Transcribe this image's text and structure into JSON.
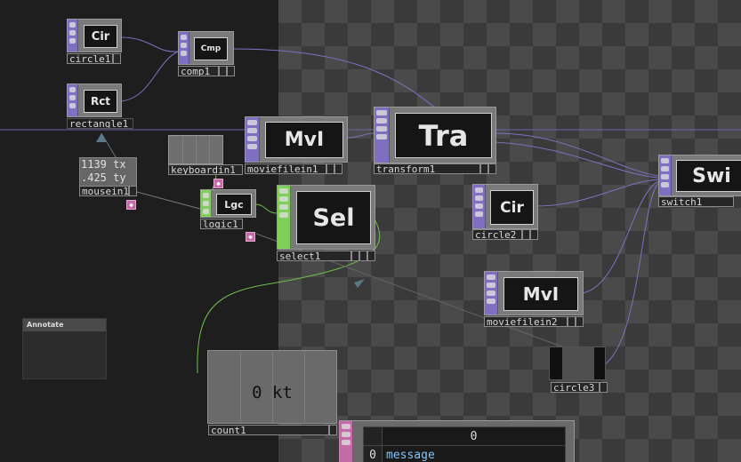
{
  "nodes": {
    "circle1": {
      "title": "Cir",
      "label": "circle1"
    },
    "rectangle1": {
      "title": "Rct",
      "label": "rectangle1"
    },
    "comp1": {
      "title": "Cmp",
      "label": "comp1"
    },
    "moviefilein1": {
      "title": "MvI",
      "label": "moviefilein1"
    },
    "transform1": {
      "title": "Tra",
      "label": "transform1"
    },
    "switch1": {
      "title": "Swi",
      "label": "switch1"
    },
    "circle2": {
      "title": "Cir",
      "label": "circle2"
    },
    "select1": {
      "title": "Sel",
      "label": "select1"
    },
    "logic1": {
      "title": "Lgc",
      "label": "logic1"
    },
    "keyboardin1": {
      "label": "keyboardin1"
    },
    "mousein1": {
      "label": "mousein1",
      "tx": "1139 tx",
      "ty": ".425 ty"
    },
    "moviefilein2": {
      "title": "MvI",
      "label": "moviefilein2"
    },
    "circle3": {
      "label": "circle3"
    },
    "count1": {
      "label": "count1",
      "value": "0 kt"
    }
  },
  "annotate": {
    "title": "Annotate"
  },
  "message_table": {
    "header": "0",
    "row_index": "0",
    "value": "message"
  },
  "colors": {
    "top_node": "#7f6fc0",
    "chop_node": "#7fcf5a",
    "dat_node": "#c46aa8"
  }
}
